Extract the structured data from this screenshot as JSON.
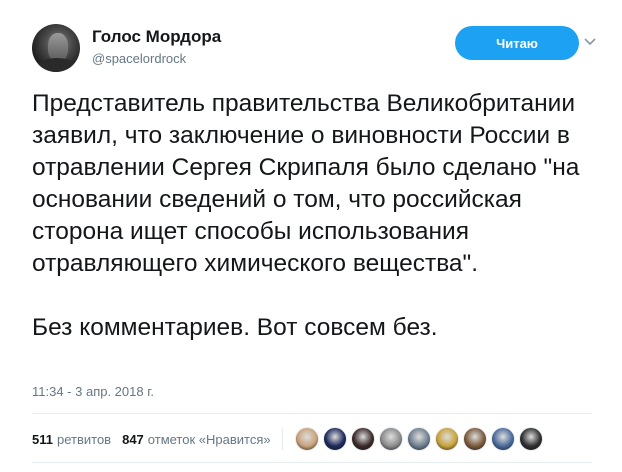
{
  "author": {
    "display_name": "Голос Мордора",
    "handle": "@spacelordrock"
  },
  "follow_button": {
    "label": "Читаю"
  },
  "tweet": {
    "text_para1": "Представитель правительства Великобритании заявил, что заключение о виновности России в отравлении Сергея Скрипаля было сделано \"на основании сведений о том, что российская сторона ищет способы использования отравляющего химического вещества\".",
    "text_para2": "Без комментариев. Вот совсем без.",
    "timestamp": "11:34 - 3 апр. 2018 г."
  },
  "stats": {
    "retweets_count": "511",
    "retweets_label": "ретвитов",
    "likes_count": "847",
    "likes_label": "отметок «Нравится»"
  },
  "likers": [
    {
      "icon": "avatar-1",
      "color": "#c9a27a"
    },
    {
      "icon": "avatar-2",
      "color": "#1e2a5a"
    },
    {
      "icon": "avatar-3",
      "color": "#3b2a2a"
    },
    {
      "icon": "avatar-4",
      "color": "#8c8c8c"
    },
    {
      "icon": "avatar-5",
      "color": "#6f7f8f"
    },
    {
      "icon": "avatar-6",
      "color": "#c8a23a"
    },
    {
      "icon": "avatar-7",
      "color": "#7a5a3a"
    },
    {
      "icon": "avatar-8",
      "color": "#4a6a9a"
    },
    {
      "icon": "avatar-9",
      "color": "#2f2f2f"
    }
  ],
  "colors": {
    "accent": "#1da1f2",
    "secondary_text": "#657786"
  }
}
